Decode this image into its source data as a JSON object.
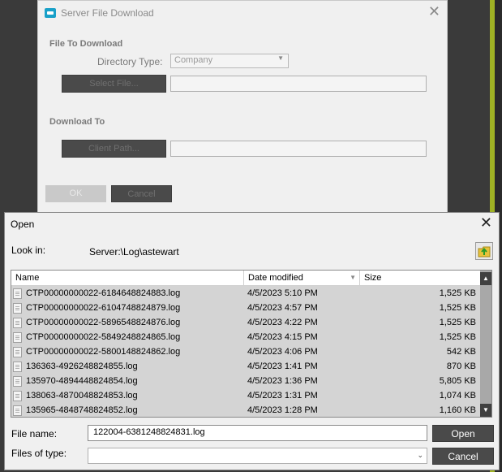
{
  "server_dialog": {
    "title": "Server File Download",
    "file_to_download": "File To Download",
    "directory_type_label": "Directory Type:",
    "directory_type_value": "Company",
    "select_file_button": "Select File...",
    "download_to": "Download To",
    "client_path_button": "Client Path...",
    "ok_button": "OK",
    "cancel_button": "Cancel"
  },
  "open_dialog": {
    "title": "Open",
    "look_in_label": "Look in:",
    "look_in_path": "Server:\\Log\\astewart",
    "columns": {
      "name": "Name",
      "date": "Date modified",
      "size": "Size"
    },
    "files": [
      {
        "name": "CTP00000000022-6184648824883.log",
        "date": "4/5/2023 5:10 PM",
        "size": "1,525 KB"
      },
      {
        "name": "CTP00000000022-6104748824879.log",
        "date": "4/5/2023 4:57 PM",
        "size": "1,525 KB"
      },
      {
        "name": "CTP00000000022-5896548824876.log",
        "date": "4/5/2023 4:22 PM",
        "size": "1,525 KB"
      },
      {
        "name": "CTP00000000022-5849248824865.log",
        "date": "4/5/2023 4:15 PM",
        "size": "1,525 KB"
      },
      {
        "name": "CTP00000000022-5800148824862.log",
        "date": "4/5/2023 4:06 PM",
        "size": "542 KB"
      },
      {
        "name": "136363-4926248824855.log",
        "date": "4/5/2023 1:41 PM",
        "size": "870 KB"
      },
      {
        "name": "135970-4894448824854.log",
        "date": "4/5/2023 1:36 PM",
        "size": "5,805 KB"
      },
      {
        "name": "138063-4870048824853.log",
        "date": "4/5/2023 1:31 PM",
        "size": "1,074 KB"
      },
      {
        "name": "135965-4848748824852.log",
        "date": "4/5/2023 1:28 PM",
        "size": "1,160 KB"
      }
    ],
    "file_name_label": "File name:",
    "file_name_value": "122004-6381248824831.log",
    "files_of_type_label": "Files of type:",
    "files_of_type_value": "",
    "open_button": "Open",
    "cancel_button": "Cancel"
  },
  "colors": {
    "accent_strip": "#9fb224",
    "row_selected": "#d4d4d4",
    "button_dark": "#4a4a4a"
  }
}
